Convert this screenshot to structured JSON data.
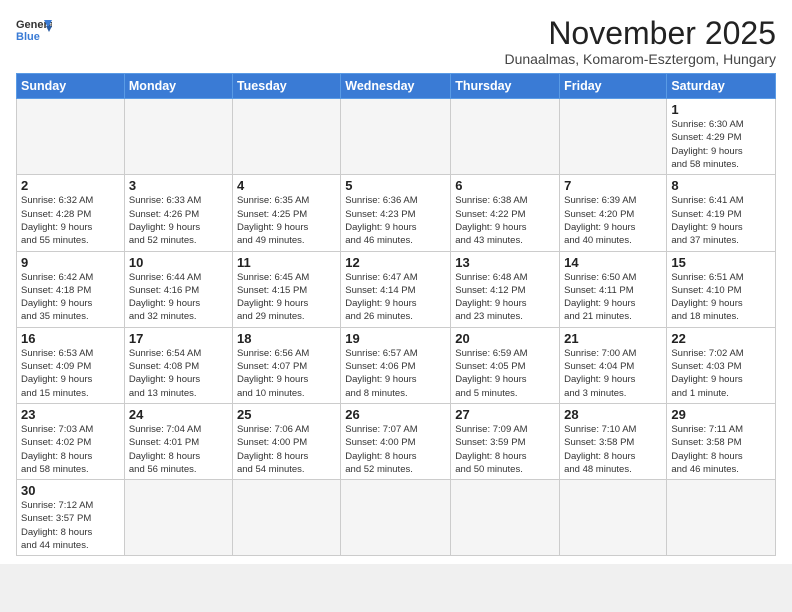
{
  "header": {
    "logo": {
      "line1": "General",
      "line2": "Blue"
    },
    "title": "November 2025",
    "subtitle": "Dunaalmas, Komarom-Esztergom, Hungary"
  },
  "weekdays": [
    "Sunday",
    "Monday",
    "Tuesday",
    "Wednesday",
    "Thursday",
    "Friday",
    "Saturday"
  ],
  "weeks": [
    [
      {
        "day": "",
        "info": ""
      },
      {
        "day": "",
        "info": ""
      },
      {
        "day": "",
        "info": ""
      },
      {
        "day": "",
        "info": ""
      },
      {
        "day": "",
        "info": ""
      },
      {
        "day": "",
        "info": ""
      },
      {
        "day": "1",
        "info": "Sunrise: 6:30 AM\nSunset: 4:29 PM\nDaylight: 9 hours\nand 58 minutes."
      }
    ],
    [
      {
        "day": "2",
        "info": "Sunrise: 6:32 AM\nSunset: 4:28 PM\nDaylight: 9 hours\nand 55 minutes."
      },
      {
        "day": "3",
        "info": "Sunrise: 6:33 AM\nSunset: 4:26 PM\nDaylight: 9 hours\nand 52 minutes."
      },
      {
        "day": "4",
        "info": "Sunrise: 6:35 AM\nSunset: 4:25 PM\nDaylight: 9 hours\nand 49 minutes."
      },
      {
        "day": "5",
        "info": "Sunrise: 6:36 AM\nSunset: 4:23 PM\nDaylight: 9 hours\nand 46 minutes."
      },
      {
        "day": "6",
        "info": "Sunrise: 6:38 AM\nSunset: 4:22 PM\nDaylight: 9 hours\nand 43 minutes."
      },
      {
        "day": "7",
        "info": "Sunrise: 6:39 AM\nSunset: 4:20 PM\nDaylight: 9 hours\nand 40 minutes."
      },
      {
        "day": "8",
        "info": "Sunrise: 6:41 AM\nSunset: 4:19 PM\nDaylight: 9 hours\nand 37 minutes."
      }
    ],
    [
      {
        "day": "9",
        "info": "Sunrise: 6:42 AM\nSunset: 4:18 PM\nDaylight: 9 hours\nand 35 minutes."
      },
      {
        "day": "10",
        "info": "Sunrise: 6:44 AM\nSunset: 4:16 PM\nDaylight: 9 hours\nand 32 minutes."
      },
      {
        "day": "11",
        "info": "Sunrise: 6:45 AM\nSunset: 4:15 PM\nDaylight: 9 hours\nand 29 minutes."
      },
      {
        "day": "12",
        "info": "Sunrise: 6:47 AM\nSunset: 4:14 PM\nDaylight: 9 hours\nand 26 minutes."
      },
      {
        "day": "13",
        "info": "Sunrise: 6:48 AM\nSunset: 4:12 PM\nDaylight: 9 hours\nand 23 minutes."
      },
      {
        "day": "14",
        "info": "Sunrise: 6:50 AM\nSunset: 4:11 PM\nDaylight: 9 hours\nand 21 minutes."
      },
      {
        "day": "15",
        "info": "Sunrise: 6:51 AM\nSunset: 4:10 PM\nDaylight: 9 hours\nand 18 minutes."
      }
    ],
    [
      {
        "day": "16",
        "info": "Sunrise: 6:53 AM\nSunset: 4:09 PM\nDaylight: 9 hours\nand 15 minutes."
      },
      {
        "day": "17",
        "info": "Sunrise: 6:54 AM\nSunset: 4:08 PM\nDaylight: 9 hours\nand 13 minutes."
      },
      {
        "day": "18",
        "info": "Sunrise: 6:56 AM\nSunset: 4:07 PM\nDaylight: 9 hours\nand 10 minutes."
      },
      {
        "day": "19",
        "info": "Sunrise: 6:57 AM\nSunset: 4:06 PM\nDaylight: 9 hours\nand 8 minutes."
      },
      {
        "day": "20",
        "info": "Sunrise: 6:59 AM\nSunset: 4:05 PM\nDaylight: 9 hours\nand 5 minutes."
      },
      {
        "day": "21",
        "info": "Sunrise: 7:00 AM\nSunset: 4:04 PM\nDaylight: 9 hours\nand 3 minutes."
      },
      {
        "day": "22",
        "info": "Sunrise: 7:02 AM\nSunset: 4:03 PM\nDaylight: 9 hours\nand 1 minute."
      }
    ],
    [
      {
        "day": "23",
        "info": "Sunrise: 7:03 AM\nSunset: 4:02 PM\nDaylight: 8 hours\nand 58 minutes."
      },
      {
        "day": "24",
        "info": "Sunrise: 7:04 AM\nSunset: 4:01 PM\nDaylight: 8 hours\nand 56 minutes."
      },
      {
        "day": "25",
        "info": "Sunrise: 7:06 AM\nSunset: 4:00 PM\nDaylight: 8 hours\nand 54 minutes."
      },
      {
        "day": "26",
        "info": "Sunrise: 7:07 AM\nSunset: 4:00 PM\nDaylight: 8 hours\nand 52 minutes."
      },
      {
        "day": "27",
        "info": "Sunrise: 7:09 AM\nSunset: 3:59 PM\nDaylight: 8 hours\nand 50 minutes."
      },
      {
        "day": "28",
        "info": "Sunrise: 7:10 AM\nSunset: 3:58 PM\nDaylight: 8 hours\nand 48 minutes."
      },
      {
        "day": "29",
        "info": "Sunrise: 7:11 AM\nSunset: 3:58 PM\nDaylight: 8 hours\nand 46 minutes."
      }
    ],
    [
      {
        "day": "30",
        "info": "Sunrise: 7:12 AM\nSunset: 3:57 PM\nDaylight: 8 hours\nand 44 minutes."
      },
      {
        "day": "",
        "info": ""
      },
      {
        "day": "",
        "info": ""
      },
      {
        "day": "",
        "info": ""
      },
      {
        "day": "",
        "info": ""
      },
      {
        "day": "",
        "info": ""
      },
      {
        "day": "",
        "info": ""
      }
    ]
  ]
}
